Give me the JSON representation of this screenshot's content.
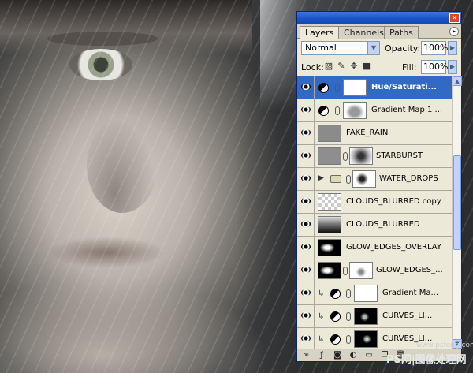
{
  "palette": {
    "close_glyph": "×",
    "tabs": [
      {
        "label": "Layers",
        "active": true
      },
      {
        "label": "Channels",
        "active": false
      },
      {
        "label": "Paths",
        "active": false
      }
    ],
    "tab_menu_glyph": "▸",
    "blend_mode": "Normal",
    "opacity_label": "Opacity:",
    "opacity_value": "100%",
    "lock_label": "Lock:",
    "fill_label": "Fill:",
    "fill_value": "100%",
    "arrow_down": "▼",
    "arrow_right": "▶"
  },
  "layers": [
    {
      "name": "Hue/Saturati...",
      "type": "adjustment",
      "selected": true,
      "clipped": false
    },
    {
      "name": "Gradient Map 1 ...",
      "type": "adjustment",
      "selected": false,
      "clipped": false
    },
    {
      "name": "FAKE_RAIN",
      "type": "pixel",
      "selected": false,
      "clipped": false
    },
    {
      "name": "STARBURST",
      "type": "pixel-mask",
      "selected": false,
      "clipped": false
    },
    {
      "name": "WATER_DROPS",
      "type": "group",
      "selected": false,
      "clipped": false
    },
    {
      "name": "CLOUDS_BLURRED copy",
      "type": "pixel",
      "selected": false,
      "clipped": false
    },
    {
      "name": "CLOUDS_BLURRED",
      "type": "pixel",
      "selected": false,
      "clipped": false
    },
    {
      "name": "GLOW_EDGES_OVERLAY",
      "type": "pixel",
      "selected": false,
      "clipped": false
    },
    {
      "name": "GLOW_EDGES_...",
      "type": "pixel-mask",
      "selected": false,
      "clipped": false
    },
    {
      "name": "Gradient Ma...",
      "type": "adjustment",
      "selected": false,
      "clipped": true
    },
    {
      "name": "CURVES_LI...",
      "type": "adjustment",
      "selected": false,
      "clipped": true
    },
    {
      "name": "CURVES_LI...",
      "type": "adjustment",
      "selected": false,
      "clipped": true
    }
  ],
  "bottom_icons": [
    "link-layers-icon",
    "layer-style-icon",
    "add-mask-icon",
    "adjustment-layer-icon",
    "new-group-icon",
    "new-layer-icon",
    "delete-layer-icon"
  ],
  "watermark": {
    "url": "www.psfeng.com",
    "text": "PS网|图像处理网"
  }
}
